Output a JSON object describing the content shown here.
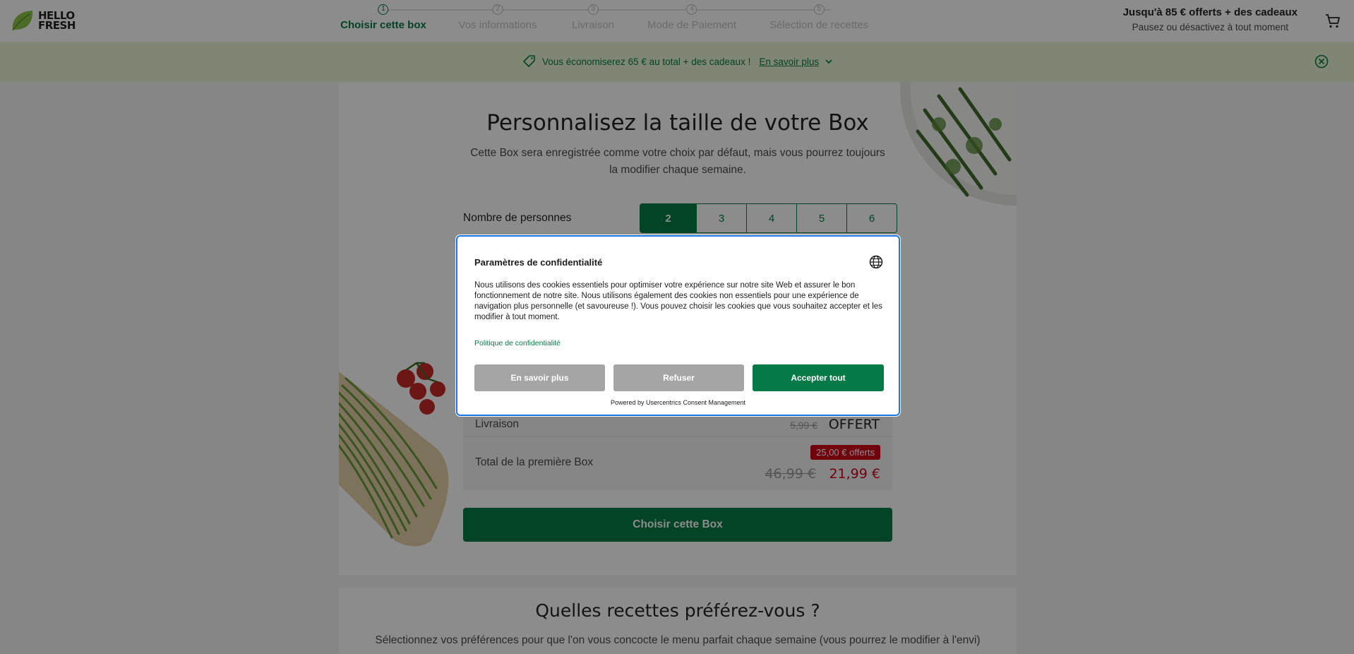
{
  "brand": {
    "logo_line1": "HELLO",
    "logo_line2": "FRESH",
    "green": "#067a46",
    "leaf_color": "#8bc34a"
  },
  "stepper": {
    "steps": [
      {
        "number": "1",
        "label": "Choisir cette box",
        "active": true
      },
      {
        "number": "2",
        "label": "Vos informations",
        "active": false
      },
      {
        "number": "3",
        "label": "Livraison",
        "active": false
      },
      {
        "number": "4",
        "label": "Mode de Paiement",
        "active": false
      },
      {
        "number": "5",
        "label": "Sélection de recettes",
        "active": false
      }
    ]
  },
  "header_promo": {
    "title": "Jusqu'à 85 € offerts + des cadeaux",
    "subtitle": "Pausez ou désactivez à tout moment"
  },
  "banner": {
    "text": "Vous économiserez 65 € au total + des cadeaux !",
    "link": "En savoir plus",
    "background": "#e9f5d3"
  },
  "box": {
    "title": "Personnalisez la taille de votre Box",
    "subtitle": "Cette Box sera enregistrée comme votre choix par défaut, mais vous pourrez toujours la modifier chaque semaine.",
    "persons_label": "Nombre de personnes",
    "persons_options": [
      "2",
      "3",
      "4",
      "5",
      "6"
    ],
    "persons_selected": "2"
  },
  "summary": {
    "delivery_label": "Livraison",
    "delivery_old_price": "5,99 €",
    "delivery_price": "OFFERT",
    "total_label": "Total de la première Box",
    "discount_badge": "25,00 € offerts",
    "total_old": "46,99 €",
    "total_new": "21,99 €",
    "price_red": "#d0021b"
  },
  "choose_button": "Choisir cette Box",
  "recipes_section": {
    "title": "Quelles recettes préférez-vous ?",
    "subtitle": "Sélectionnez vos préférences pour que l'on vous concocte le menu parfait chaque semaine (vous pourrez le modifier à l'envi)"
  },
  "consent": {
    "title": "Paramètres de confidentialité",
    "body": "Nous utilisons des cookies essentiels pour optimiser votre expérience sur notre site Web et assurer le bon fonctionnement de notre site. Nous utilisons également des cookies non essentiels pour une expérience de navigation plus personnelle (et savoureuse !). Vous pouvez choisir les cookies que vous souhaitez accepter et les modifier à tout moment.",
    "policy_link": "Politique de confidentialité",
    "more_button": "En savoir plus",
    "refuse_button": "Refuser",
    "accept_button": "Accepter tout",
    "powered_by": "Powered by Usercentrics Consent Management"
  }
}
